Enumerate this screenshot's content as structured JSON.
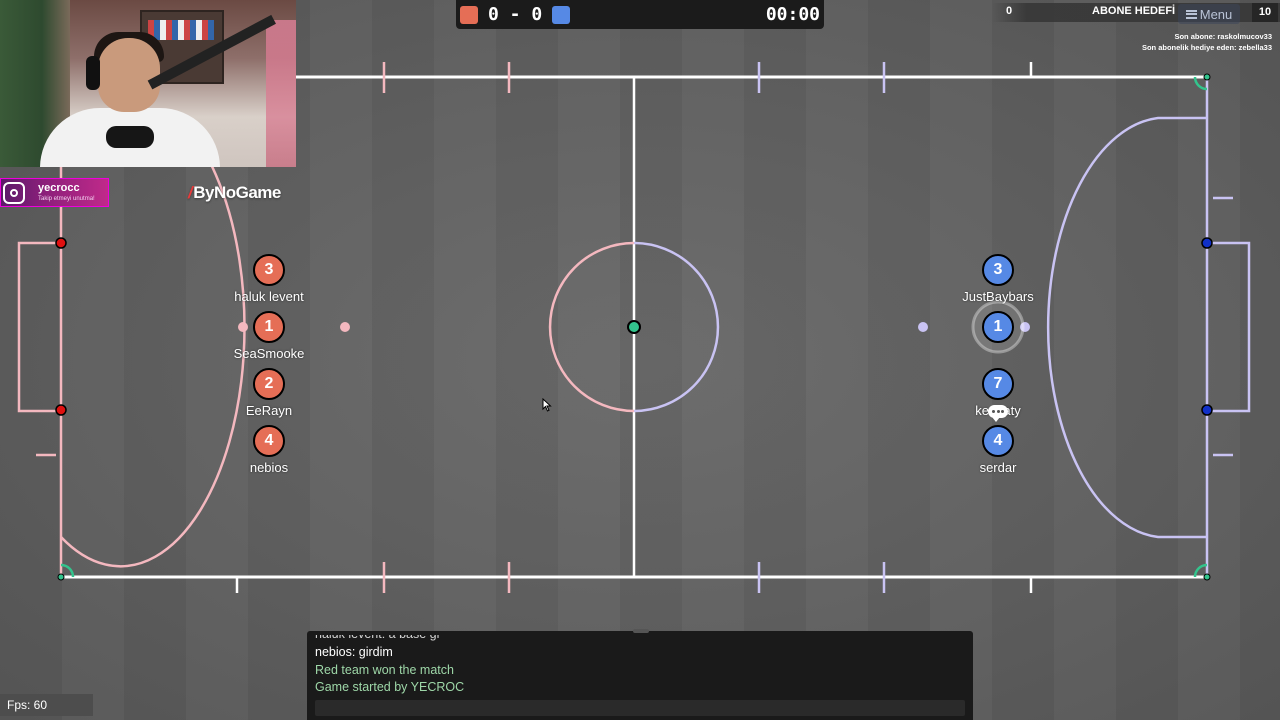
{
  "colors": {
    "red_team": "#e56e56",
    "blue_team": "#5689e5",
    "line_white": "#ffffff",
    "line_red": "#f4b8bf",
    "line_blue": "#c9c3f3",
    "ball": "#33c48d"
  },
  "overlay": {
    "instagram_handle": "yecrocc",
    "instagram_sub": "Takip etmeyi unutma!",
    "instagram_icon": "instagram-icon",
    "brand": "ByNoGame",
    "subscribe_current": "0",
    "subscribe_goal_label": "ABONE HEDEFİ",
    "subscribe_goal": "10",
    "last_sub": "Son abone: raskolmucov33",
    "last_gift": "Son abonelik hediye eden: zebella33"
  },
  "scoreboard": {
    "score": "0 - 0",
    "time": "00:00"
  },
  "menu": {
    "label": "Menu",
    "icon": "hamburger-icon"
  },
  "red_team": [
    {
      "number": "3",
      "name": "haluk levent"
    },
    {
      "number": "1",
      "name": "SeaSmooke"
    },
    {
      "number": "2",
      "name": "EeRayn"
    },
    {
      "number": "4",
      "name": "nebios"
    }
  ],
  "blue_team": [
    {
      "number": "3",
      "name": "JustBaybars"
    },
    {
      "number": "1",
      "name": ""
    },
    {
      "number": "7",
      "name": "kenpaty"
    },
    {
      "number": "4",
      "name": "serdar"
    }
  ],
  "chat": {
    "messages": [
      {
        "text": "haluk levent: a base gi",
        "type": "player"
      },
      {
        "text": "nebios: girdim",
        "type": "player"
      },
      {
        "text": "Red team won the match",
        "type": "system"
      },
      {
        "text": "Game started by YECROC",
        "type": "system"
      }
    ]
  },
  "fps": "Fps: 60"
}
